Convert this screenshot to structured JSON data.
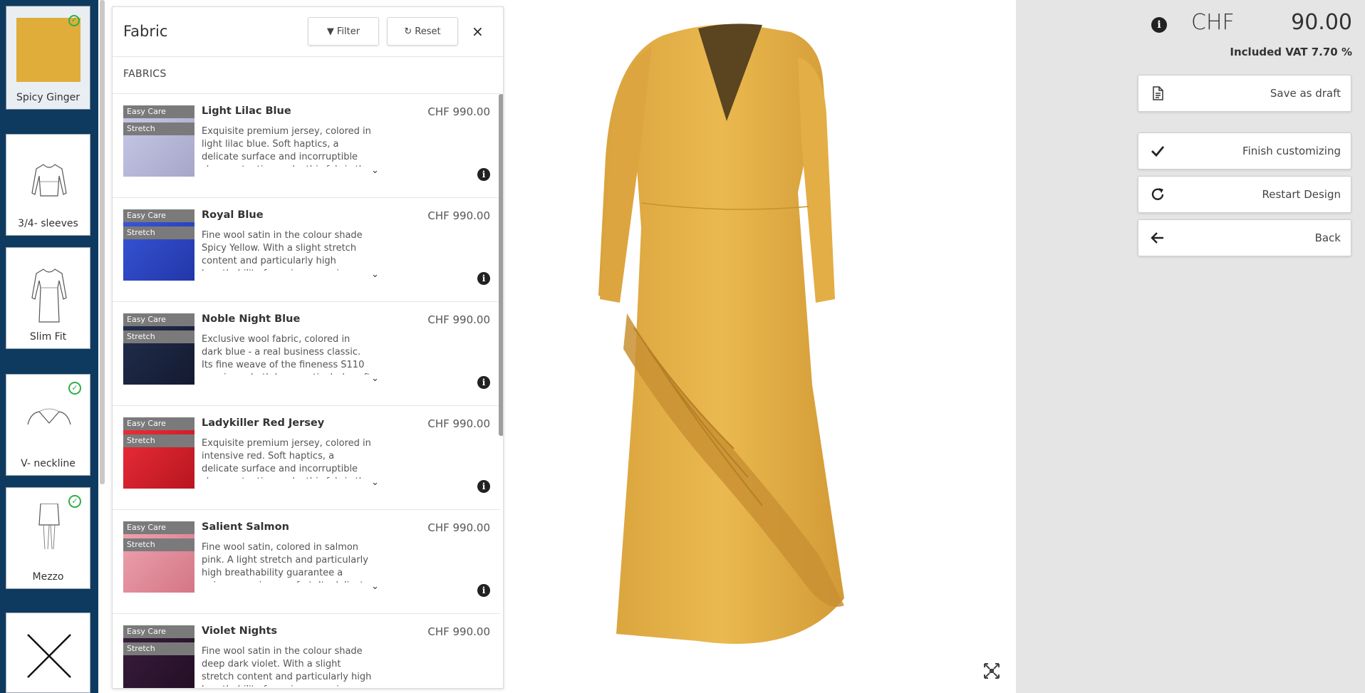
{
  "rail": {
    "items": [
      {
        "label": "Spicy Ginger",
        "type": "swatch",
        "color": "#e0ad3a",
        "selected": true,
        "checked": true
      },
      {
        "label": "3/4- sleeves",
        "type": "sketch",
        "icon": "sleeves-sketch-icon",
        "checked": false
      },
      {
        "label": "Slim Fit",
        "type": "sketch",
        "icon": "slim-fit-sketch-icon",
        "checked": false
      },
      {
        "label": "V- neckline",
        "type": "sketch",
        "icon": "v-neckline-sketch-icon",
        "checked": true
      },
      {
        "label": "Mezzo",
        "type": "sketch",
        "icon": "mezzo-length-sketch-icon",
        "checked": true
      },
      {
        "label": "",
        "type": "sketch",
        "icon": "x-none-icon",
        "checked": false
      }
    ]
  },
  "panel": {
    "title": "Fabric",
    "filter_label": "Filter",
    "reset_label": "Reset",
    "close_label": "×",
    "section_label": "FABRICS"
  },
  "fabrics": [
    {
      "name": "Light Lilac Blue",
      "price": "CHF 990.00",
      "tag1": "Easy Care",
      "tag2": "Stretch",
      "color": "#b9b8d8",
      "desc": "Exquisite premium jersey, colored in light lilac blue. Soft haptics, a delicate surface and incorruptible shape retention make this fabric the essential"
    },
    {
      "name": "Royal Blue",
      "price": "CHF 990.00",
      "tag1": "Easy Care",
      "tag2": "Stretch",
      "color": "#2e48c8",
      "desc": "Fine wool satin in the colour shade Spicy Yellow. With a slight stretch content and particularly high breathability for unique wearing"
    },
    {
      "name": "Noble Night Blue",
      "price": "CHF 990.00",
      "tag1": "Easy Care",
      "tag2": "Stretch",
      "color": "#1a2440",
      "desc": "Exclusive wool fabric, colored in dark blue - a real business classic. Its fine weave of the fineness S110 convinces both by a particularly soft fall and"
    },
    {
      "name": "Ladykiller Red Jersey",
      "price": "CHF 990.00",
      "tag1": "Easy Care",
      "tag2": "Stretch",
      "color": "#e0202a",
      "desc": "Exquisite premium jersey, colored in intensive red. Soft haptics, a delicate surface and incorruptible shape retention make this fabric the essential"
    },
    {
      "name": "Salient Salmon",
      "price": "CHF 990.00",
      "tag1": "Easy Care",
      "tag2": "Stretch",
      "color": "#e58e9e",
      "desc": "Fine wool satin, colored in salmon pink. A light stretch and particularly high breathability guarantee a unique wearing comfort. Its delicate haptics"
    },
    {
      "name": "Violet Nights",
      "price": "CHF 990.00",
      "tag1": "Easy Care",
      "tag2": "Stretch",
      "color": "#2e1630",
      "desc": "Fine wool satin in the colour shade deep dark violet. With a slight stretch content and particularly high breathability for unique wearing"
    }
  ],
  "summary": {
    "currency": "CHF",
    "price": "90.00",
    "vat": "Included VAT 7.70 %"
  },
  "actions": [
    {
      "label": "Save as draft",
      "icon": "document-icon"
    },
    {
      "label": "Finish customizing",
      "icon": "checkmark-icon"
    },
    {
      "label": "Restart Design",
      "icon": "restart-icon"
    },
    {
      "label": "Back",
      "icon": "arrow-left-icon"
    }
  ],
  "colors": {
    "rail_bg": "#0e3a5f",
    "dress": "#e4b04a",
    "check_green": "#2fae4a"
  }
}
